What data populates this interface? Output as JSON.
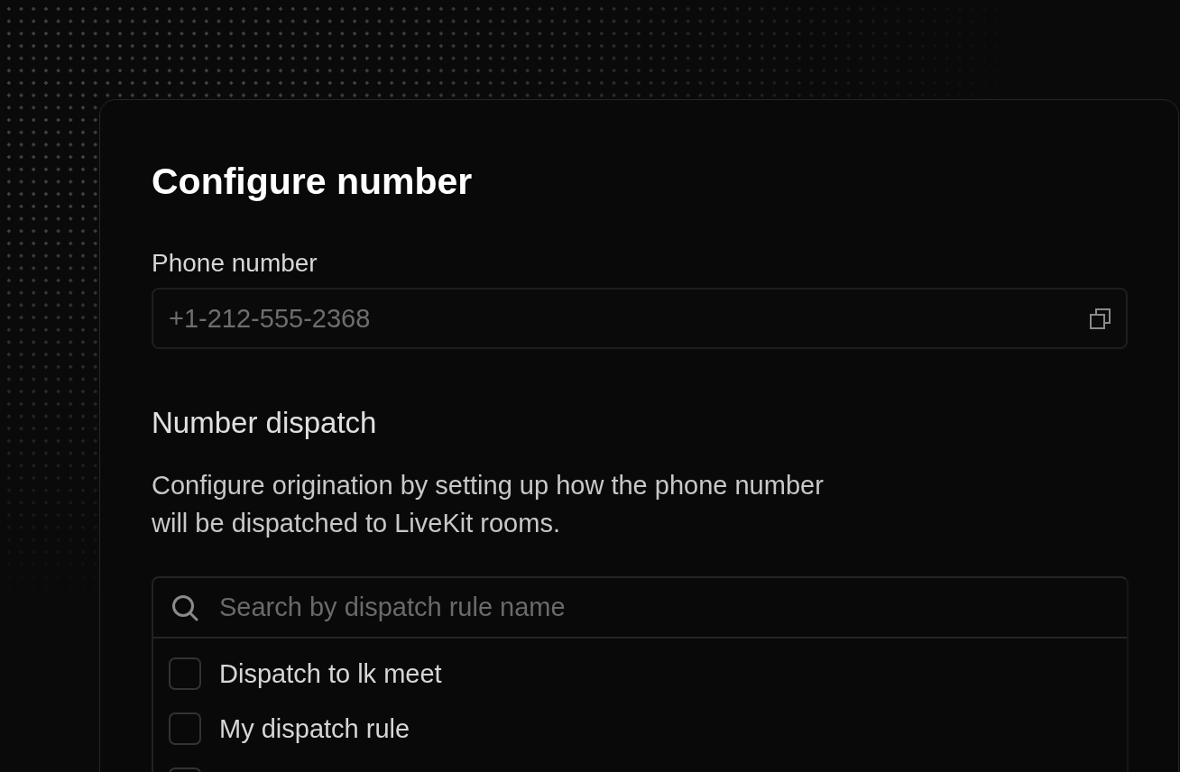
{
  "dialog": {
    "title": "Configure number",
    "phone_field": {
      "label": "Phone number",
      "value": "+1-212-555-2368"
    },
    "dispatch": {
      "heading": "Number dispatch",
      "description": "Configure origination by setting up how the phone number will be dispatched to LiveKit rooms.",
      "search": {
        "placeholder": "Search by dispatch rule name"
      },
      "rules": [
        {
          "label": "Dispatch to lk meet",
          "checked": false
        },
        {
          "label": "My dispatch rule",
          "checked": false
        },
        {
          "checked": false
        }
      ]
    }
  }
}
